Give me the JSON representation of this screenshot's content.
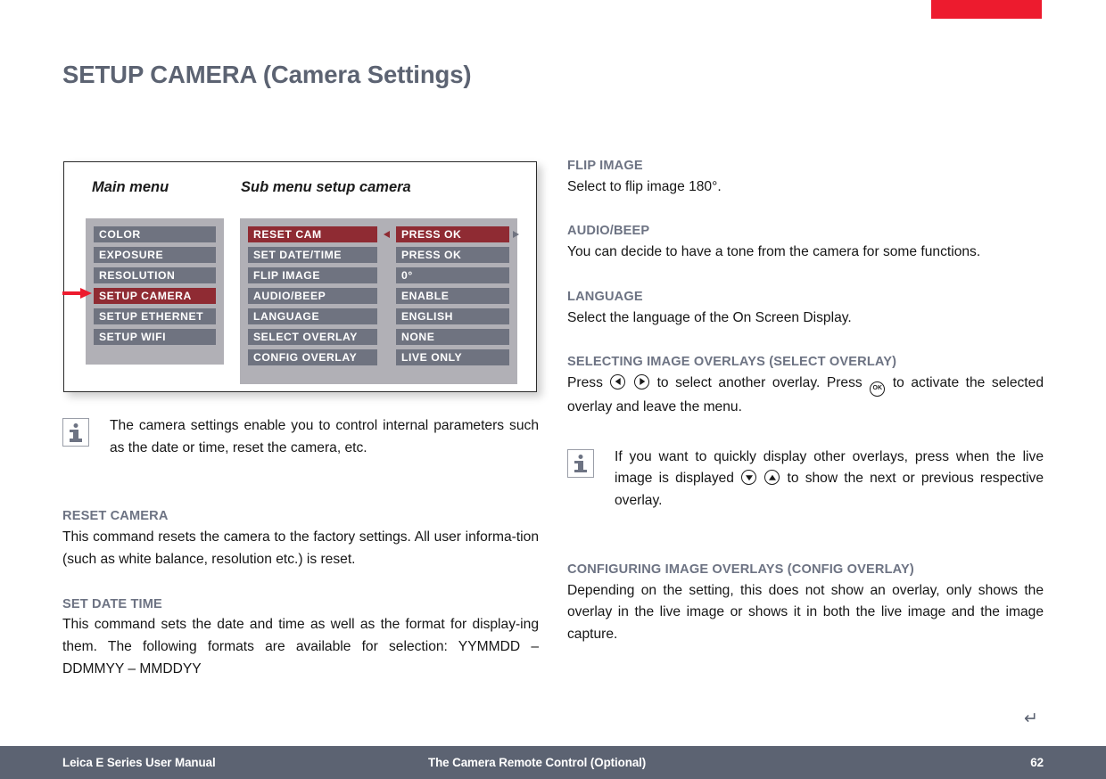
{
  "document": {
    "page_title": "SETUP CAMERA (Camera Settings)",
    "return_glyph": "↵"
  },
  "diagram": {
    "main_menu_label": "Main menu",
    "sub_menu_label": "Sub menu setup camera",
    "selected_color": "#8f2b33",
    "row_color": "#6f7380",
    "panel_color": "#b1b0b6",
    "pointer_color": "#ed1b2e",
    "main_menu": {
      "items": [
        {
          "label": "COLOR",
          "selected": false
        },
        {
          "label": "EXPOSURE",
          "selected": false
        },
        {
          "label": "RESOLUTION",
          "selected": false
        },
        {
          "label": "SETUP CAMERA",
          "selected": true
        },
        {
          "label": "SETUP ETHERNET",
          "selected": false
        },
        {
          "label": "SETUP WIFI",
          "selected": false
        }
      ]
    },
    "sub_menu": {
      "items": [
        {
          "name": "RESET CAM",
          "value": "PRESS OK",
          "selected": true
        },
        {
          "name": "SET DATE/TIME",
          "value": "PRESS OK",
          "selected": false
        },
        {
          "name": "FLIP IMAGE",
          "value": "0°",
          "selected": false
        },
        {
          "name": "AUDIO/BEEP",
          "value": "ENABLE",
          "selected": false
        },
        {
          "name": "LANGUAGE",
          "value": "ENGLISH",
          "selected": false
        },
        {
          "name": "SELECT OVERLAY",
          "value": "NONE",
          "selected": false
        },
        {
          "name": "CONFIG OVERLAY",
          "value": "LIVE ONLY",
          "selected": false
        }
      ]
    }
  },
  "left_column": {
    "note": "The camera settings enable you to control internal parameters such as the date or time, reset the camera, etc.",
    "sections": [
      {
        "heading": "RESET CAMERA",
        "body": "This command resets the camera to the factory settings. All user informa-tion (such as white balance, resolution etc.) is reset."
      },
      {
        "heading": "SET DATE TIME",
        "body": "This command sets the date and time as well as the format for display-ing them. The following formats are available for selection: YYMMDD – DDMMYY – MMDDYY"
      }
    ]
  },
  "right_column": {
    "sections": [
      {
        "heading": "FLIP IMAGE",
        "body": "Select to flip image 180°."
      },
      {
        "heading": "AUDIO/BEEP",
        "body": "You can decide to have a tone from the camera for some functions."
      },
      {
        "heading": "LANGUAGE",
        "body": "Select the language of the On Screen Display."
      },
      {
        "heading": "SELECTING IMAGE OVERLAYS (SELECT OVERLAY)",
        "body_part_1": "Press",
        "body_part_2": "to select another overlay. Press",
        "body_part_3": "to activate the selected overlay and leave the menu."
      },
      {
        "heading": "CONFIGURING IMAGE OVERLAYS (CONFIG OVERLAY)",
        "body": "Depending on the setting, this does not show an overlay, only shows the overlay in the live image or shows it in both the live image and the image capture."
      }
    ],
    "note": {
      "part_1": "If you want to quickly display other overlays, press when the live image is displayed",
      "part_2": "to show the next or previous respective overlay."
    },
    "keys": {
      "ok_label": "OK"
    }
  },
  "footer": {
    "left": "Leica E Series User Manual",
    "center": "The Camera Remote Control (Optional)",
    "page_number": "62"
  }
}
